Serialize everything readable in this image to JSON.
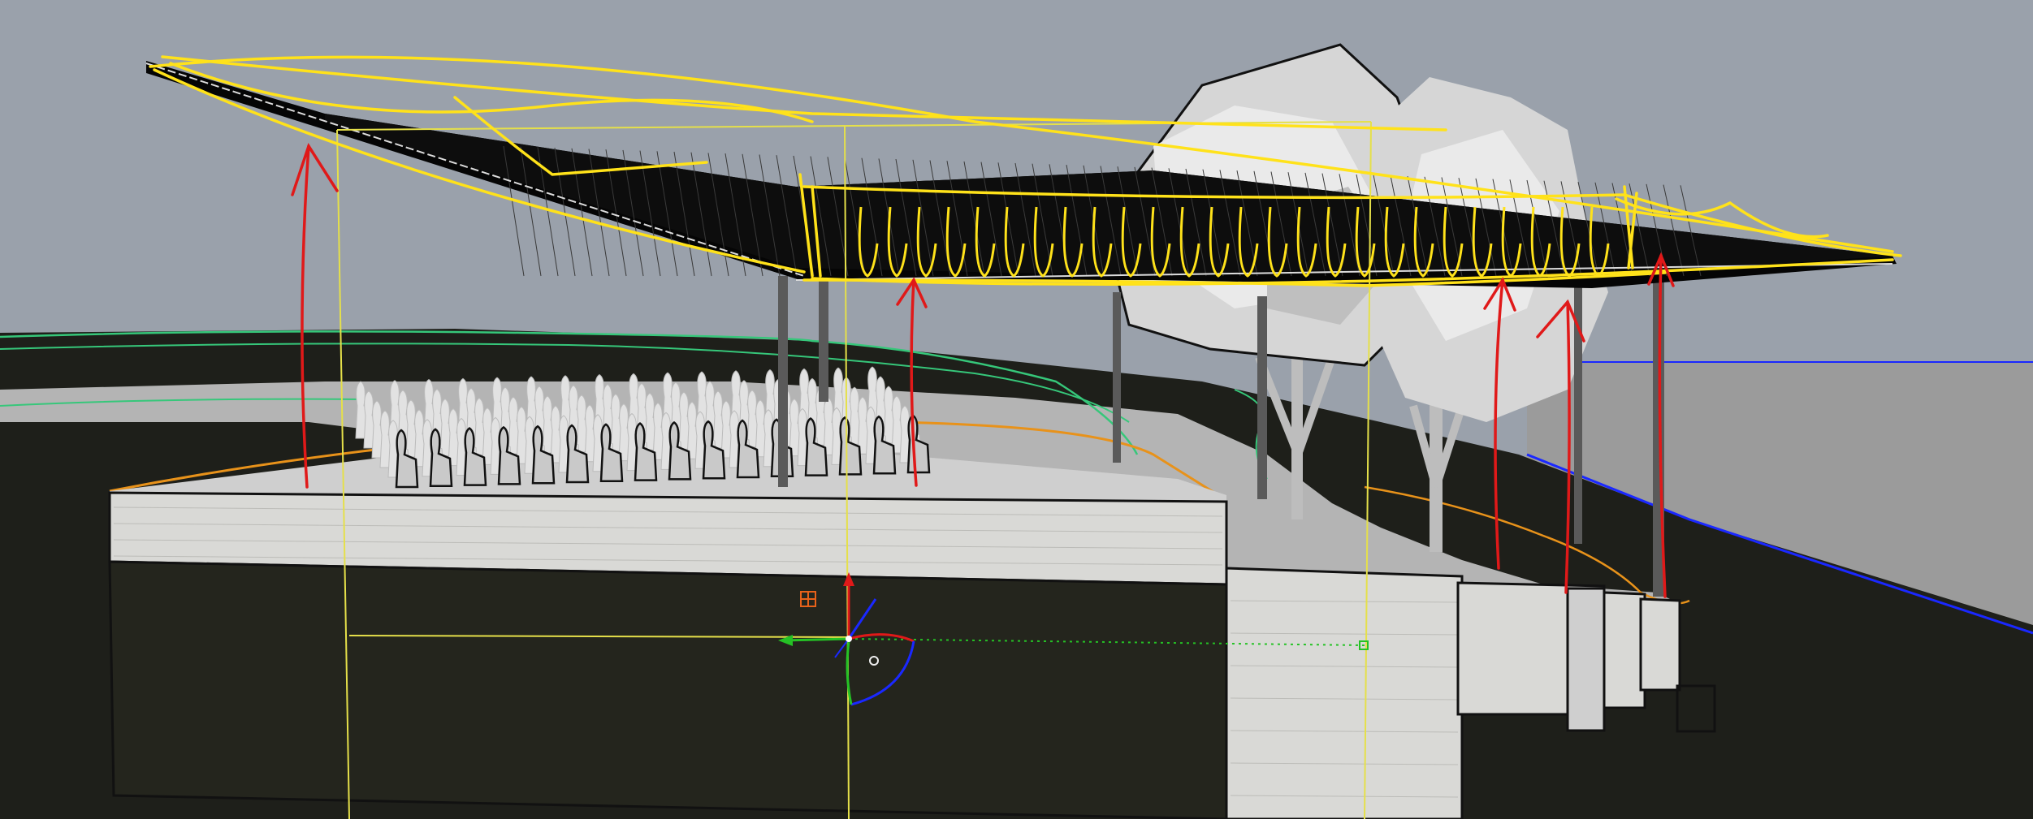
{
  "viewport": {
    "label": "",
    "background_color": "#9aa1ab",
    "ground_color": "#1e1f1a",
    "platform_color": "#d9d9d6",
    "roof_color": "#050505",
    "tree_color": "#d6d6d6",
    "sketch_color": "#ffe21a",
    "arrow_color": "#e01919",
    "guide_color": "#e5e04a",
    "contour_green": "#36c77a",
    "contour_orange": "#e8921a",
    "horizon_blue": "#1a28ff"
  },
  "gizmo": {
    "x_axis_color": "#e01919",
    "y_axis_color": "#25c225",
    "z_axis_color": "#1a28ff",
    "icons": [
      "move-gizmo-icon",
      "rotate-gizmo-icon",
      "scale-gizmo-icon",
      "snap-grid-icon"
    ]
  },
  "scene_objects": [
    "canopy-roof",
    "canopy-column",
    "seated-audience",
    "stone-platform",
    "tree",
    "terrain",
    "stair-steps"
  ]
}
